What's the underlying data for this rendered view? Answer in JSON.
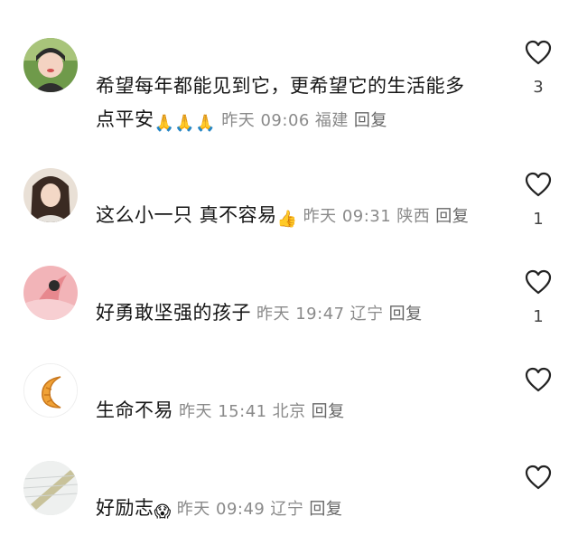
{
  "comments": [
    {
      "text_line1": "希望每年都能见到它，更希望它的生活能多",
      "text_line2": "点平安",
      "emoji": "🙏🙏🙏",
      "time": "昨天 09:06",
      "location": "福建",
      "reply": "回复",
      "likes": "3"
    },
    {
      "text": "这么小一只 真不容易",
      "emoji": "👍",
      "time": "昨天 09:31",
      "location": "陕西",
      "reply": "回复",
      "likes": "1"
    },
    {
      "text": "好勇敢坚强的孩子",
      "time": "昨天 19:47",
      "location": "辽宁",
      "reply": "回复",
      "likes": "1"
    },
    {
      "text": "生命不易",
      "time": "昨天 15:41",
      "location": "北京",
      "reply": "回复",
      "likes": ""
    },
    {
      "text": "好励志",
      "emoji": "😱",
      "time": "昨天 09:49",
      "location": "辽宁",
      "reply": "回复",
      "likes": ""
    }
  ],
  "icons": {
    "like": "heart-outline-icon"
  },
  "colors": {
    "meta": "#8a8a8a",
    "text": "#161616"
  }
}
